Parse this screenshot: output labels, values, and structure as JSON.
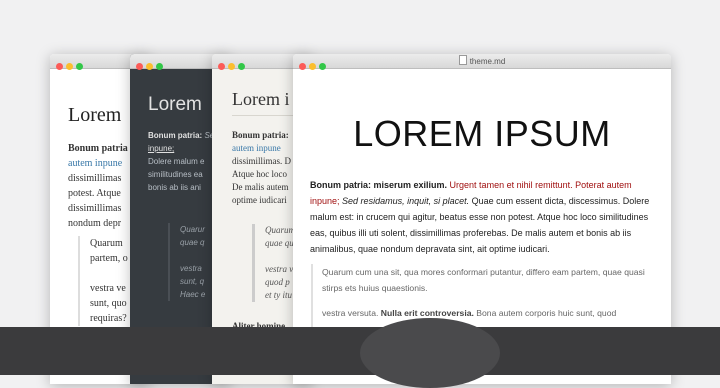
{
  "colors": {
    "background": "#f1f1f2",
    "dark_theme_bg": "#363b40",
    "sepia_theme_bg": "#f3f2ee",
    "link": "#3978a8",
    "accent_red": "#a01010"
  },
  "window1": {
    "heading": "Lorem",
    "p_bold": "Bonum patria",
    "p_link": "autem inpune",
    "p_rest": "dissimillimas potest. Atque dissimillimas nondum depr",
    "p_rest_a": "dissimillimas",
    "p_rest_b": "potest. Atque",
    "p_rest_c": "dissimillimas",
    "p_rest_d": "nondum depr",
    "bq_line1": "Quarum",
    "bq_line2": "partem, o",
    "bq_line3": "vestra ve",
    "bq_line4": "sunt, quo",
    "bq_line5": "requiras?"
  },
  "window2": {
    "heading": "Lorem",
    "p_bold": "Bonum patria:",
    "p_italic": "Sed resi",
    "p_underline": "inpune;",
    "p_line3": "Dolere malum e",
    "p_line4": "similitudines ea",
    "p_line5": "bonis ab iis ani",
    "bq_line1": "Quarur",
    "bq_line2": "quae q",
    "bq_line3": "vestra",
    "bq_line4": "sunt, q",
    "bq_line5": "Haec e"
  },
  "window3": {
    "heading": "Lorem i",
    "p_bold": "Bonum patria:",
    "p_link": "autem inpune",
    "p_line3": "dissimillimas. D",
    "p_line4": "Atque hoc loco",
    "p_line5": "De malis autem",
    "p_line6": "optime iudicari",
    "bq_line1": "Quarum",
    "bq_line2": "quae qu",
    "bq_line3": "vestra v",
    "bq_line4": "quod p",
    "bq_line5": "et ty itu",
    "p2": "Aliter homine"
  },
  "window4": {
    "title": "theme.md",
    "heading": "LOREM IPSUM",
    "p_bold": "Bonum patria: miserum exilium.",
    "p_red": "Urgent tamen et nihil remittunt. Poterat autem inpune;",
    "p_italic": "Sed residamus, inquit, si placet.",
    "p_rest": "Quae cum essent dicta, discessimus. Dolere malum est: in crucem qui agitur, beatus esse non potest. Atque hoc loco similitudines eas, quibus illi uti solent, dissimillimas proferebas. De malis autem et bonis ab iis animalibus, quae nondum depravata sint, ait optime iudicari.",
    "bq_p1": "Quarum cum una sit, qua mores conformari putantur, differo eam partem, quae quasi stirps ets huius quaestionis.",
    "bq_p2_start": "vestra versuta.",
    "bq_p2_bold": "Nulla erit controversia.",
    "bq_p2_rest": "Bona autem corporis huic sunt, quod"
  }
}
